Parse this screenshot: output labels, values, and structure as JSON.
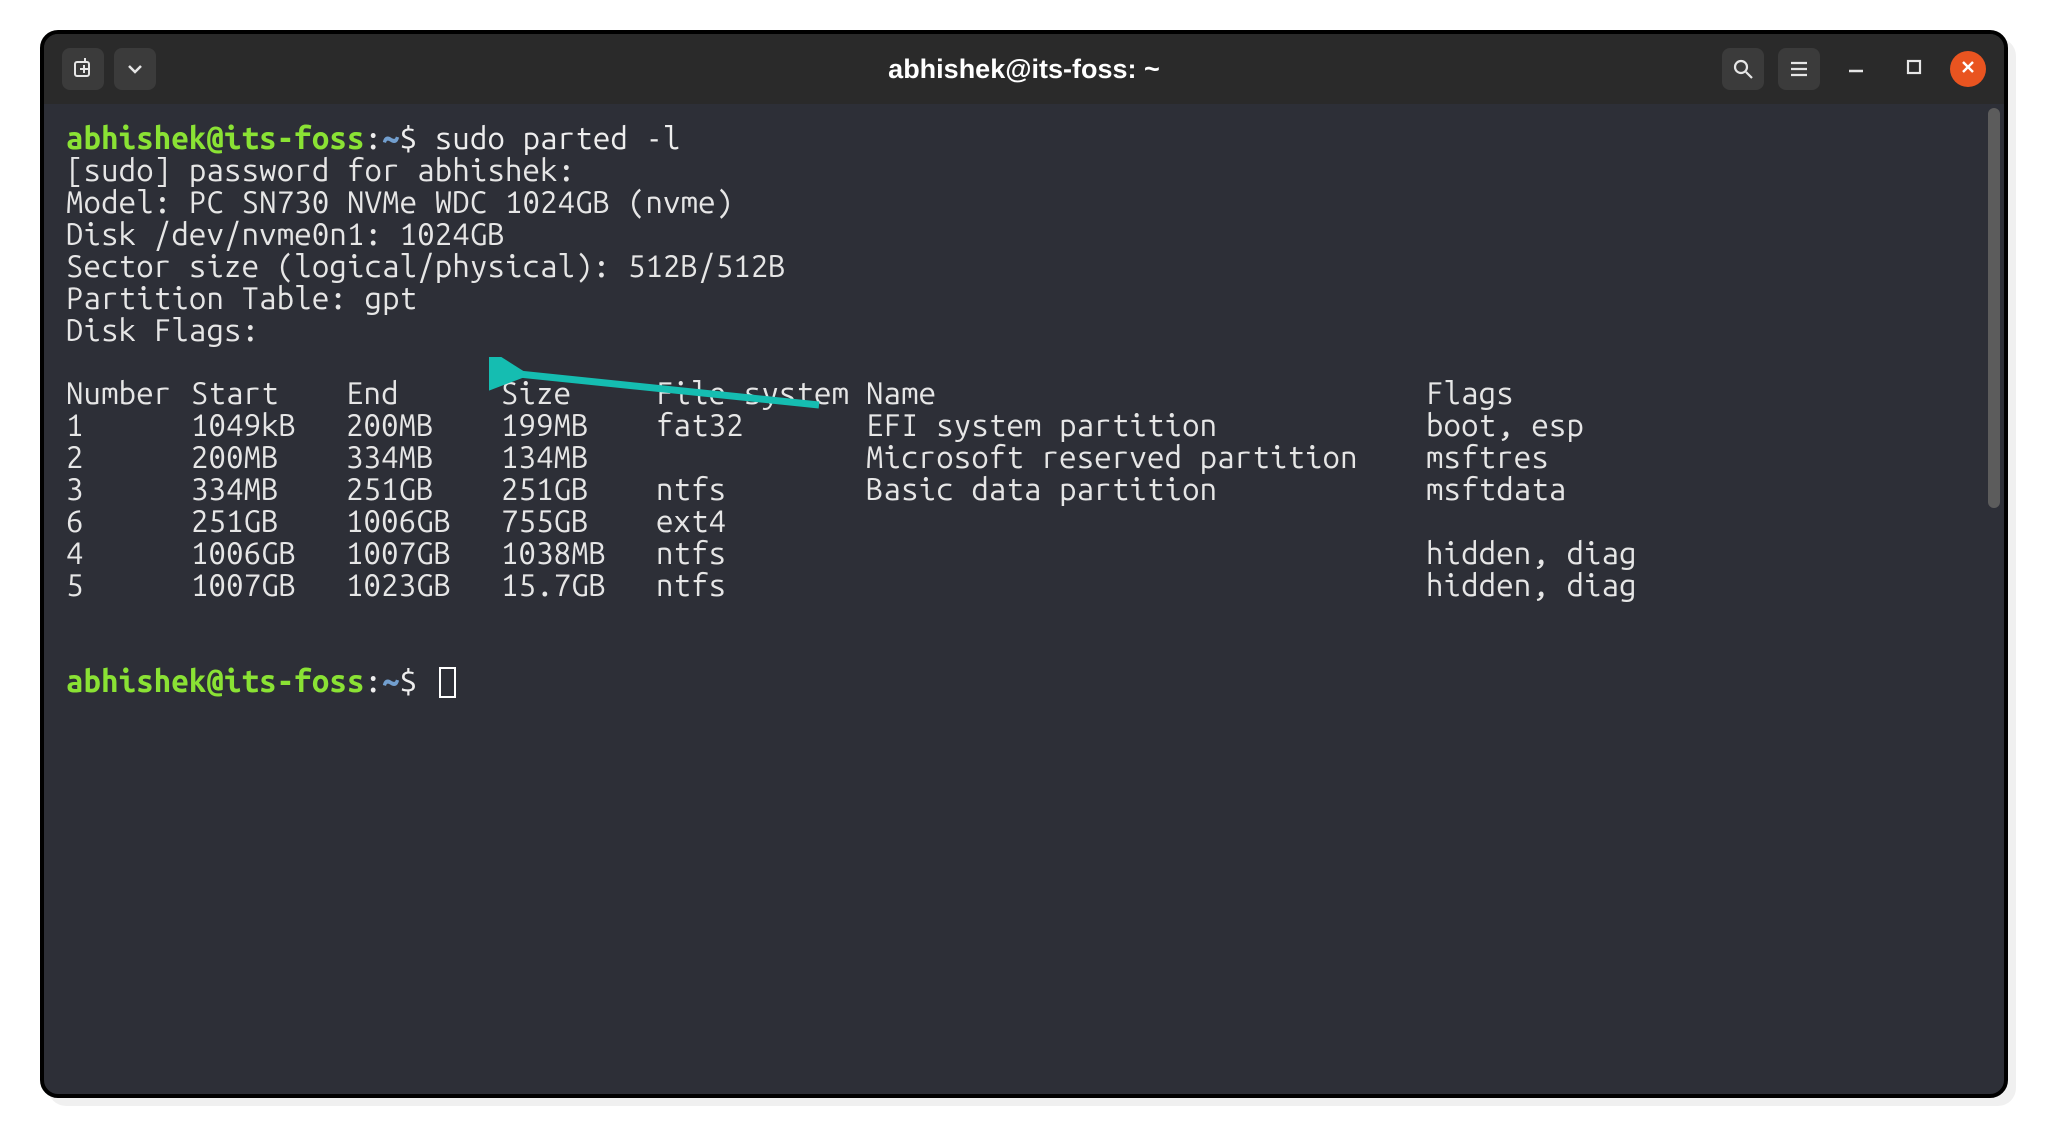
{
  "window": {
    "title": "abhishek@its-foss: ~"
  },
  "prompt": {
    "user_host": "abhishek@its-foss",
    "sep": ":",
    "cwd": "~",
    "dollar": "$ ",
    "command": "sudo parted -l"
  },
  "lines": {
    "sudo_prompt": "[sudo] password for abhishek: ",
    "model": "Model: PC SN730 NVMe WDC 1024GB (nvme)",
    "disk": "Disk /dev/nvme0n1: 1024GB",
    "sector": "Sector size (logical/physical): 512B/512B",
    "pt_label": "Partition Table: ",
    "pt_value": "gpt",
    "flags": "Disk Flags: "
  },
  "table": {
    "headers": [
      "Number",
      "Start",
      "End",
      "Size",
      "File system",
      "Name",
      "Flags"
    ],
    "rows": [
      [
        "1",
        "1049kB",
        "200MB",
        "199MB",
        "fat32",
        "EFI system partition",
        "boot, esp"
      ],
      [
        "2",
        "200MB",
        "334MB",
        "134MB",
        "",
        "Microsoft reserved partition",
        "msftres"
      ],
      [
        "3",
        "334MB",
        "251GB",
        "251GB",
        "ntfs",
        "Basic data partition",
        "msftdata"
      ],
      [
        "6",
        "251GB",
        "1006GB",
        "755GB",
        "ext4",
        "",
        ""
      ],
      [
        "4",
        "1006GB",
        "1007GB",
        "1038MB",
        "ntfs",
        "",
        "hidden, diag"
      ],
      [
        "5",
        "1007GB",
        "1023GB",
        "15.7GB",
        "ntfs",
        "",
        "hidden, diag"
      ]
    ]
  },
  "annotation": {
    "arrow_color": "#15bdb1"
  }
}
